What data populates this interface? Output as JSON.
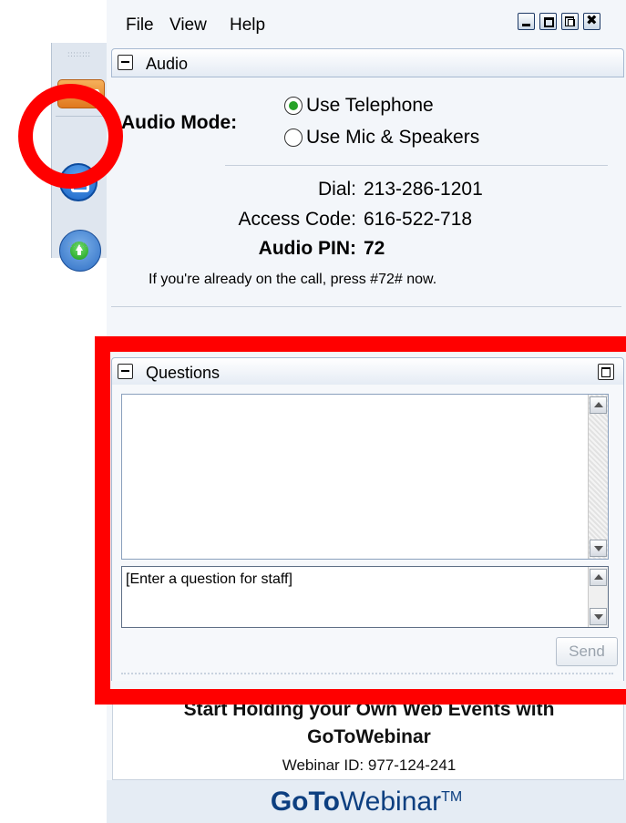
{
  "menu": {
    "file": "File",
    "view": "View",
    "help": "Help"
  },
  "audio": {
    "section_title": "Audio",
    "mode_label": "Audio Mode:",
    "options": [
      "Use Telephone",
      "Use Mic & Speakers"
    ],
    "selected": "Use Telephone",
    "dial_label": "Dial:",
    "dial_value": "213-286-1201",
    "access_label": "Access Code:",
    "access_value": "616-522-718",
    "pin_label": "Audio PIN:",
    "pin_value": "72",
    "note": "If you're already on the call, press #72# now."
  },
  "questions": {
    "section_title": "Questions",
    "input_placeholder": "[Enter a question for staff]",
    "send_label": "Send"
  },
  "promo": {
    "line1": "Start Holding your Own Web Events with",
    "line2": "GoToWebinar",
    "webinar_id": "Webinar ID: 977-124-241"
  },
  "brand": {
    "bold": "GoTo",
    "rest": "Webinar",
    "tm": "TM",
    "color": "#0d3f80"
  },
  "annotations": {
    "highlight_color": "#ff0000"
  }
}
